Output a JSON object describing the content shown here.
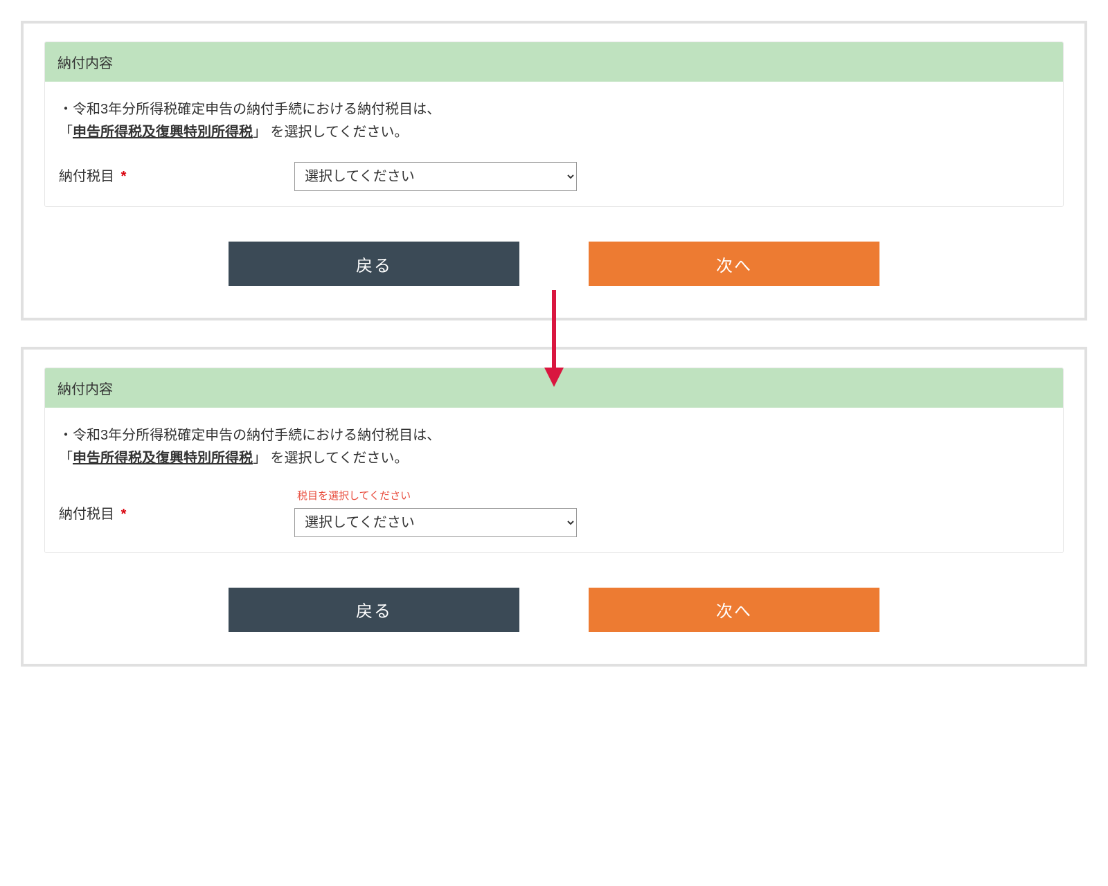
{
  "panel": {
    "title": "納付内容",
    "instruction_prefix": "・令和3年分所得税確定申告の納付手続における納付税目は、",
    "instruction_open_bracket": "「",
    "instruction_tax_name": "申告所得税及復興特別所得税",
    "instruction_close_text": "」 を選択してください。",
    "field_label": "納付税目",
    "required_mark": "*",
    "select_placeholder": "選択してください",
    "error_message": "税目を選択してください"
  },
  "buttons": {
    "back": "戻る",
    "next": "次へ"
  }
}
